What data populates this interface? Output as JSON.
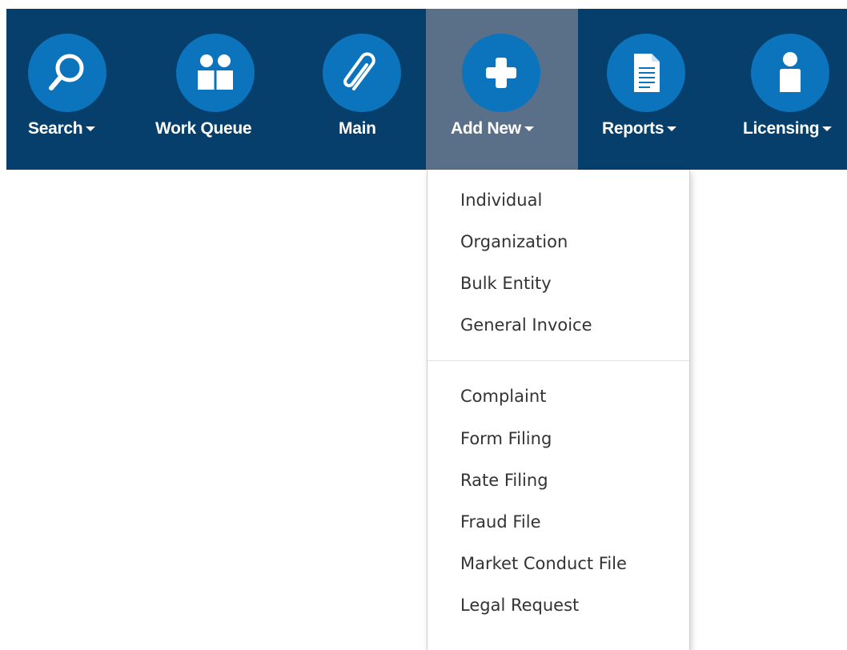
{
  "nav": {
    "items": [
      {
        "label": "Search",
        "icon": "search-icon",
        "has_caret": true
      },
      {
        "label": "Work Queue",
        "icon": "people-icon",
        "has_caret": false
      },
      {
        "label": "Main",
        "icon": "paperclip-icon",
        "has_caret": false
      },
      {
        "label": "Add New",
        "icon": "plus-icon",
        "has_caret": true,
        "active": true
      },
      {
        "label": "Reports",
        "icon": "document-icon",
        "has_caret": true
      },
      {
        "label": "Licensing",
        "icon": "person-icon",
        "has_caret": true
      }
    ]
  },
  "dropdown": {
    "group1": [
      "Individual",
      "Organization",
      "Bulk Entity",
      "General Invoice"
    ],
    "group2": [
      "Complaint",
      "Form Filing",
      "Rate Filing",
      "Fraud File",
      "Market Conduct File",
      "Legal Request"
    ]
  },
  "colors": {
    "navbar_bg": "#063f6b",
    "active_bg": "#5a7089",
    "icon_circle": "#0b74bd",
    "menu_text": "#333333"
  }
}
